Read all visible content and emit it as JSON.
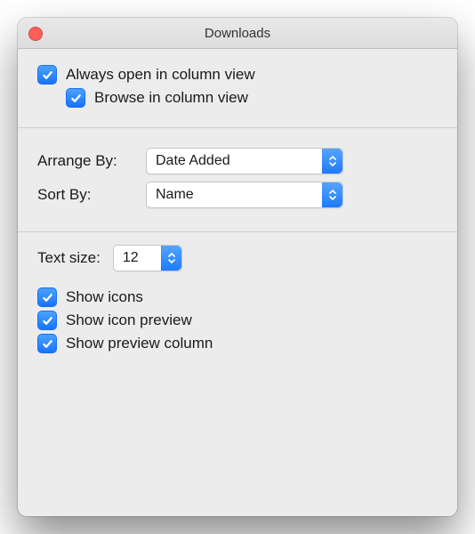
{
  "window": {
    "title": "Downloads"
  },
  "section_view": {
    "always_open_label": "Always open in column view",
    "browse_label": "Browse in column view"
  },
  "section_sort": {
    "arrange_by_label": "Arrange By:",
    "arrange_by_value": "Date Added",
    "sort_by_label": "Sort By:",
    "sort_by_value": "Name"
  },
  "section_display": {
    "text_size_label": "Text size:",
    "text_size_value": "12",
    "show_icons_label": "Show icons",
    "show_icon_preview_label": "Show icon preview",
    "show_preview_column_label": "Show preview column"
  }
}
